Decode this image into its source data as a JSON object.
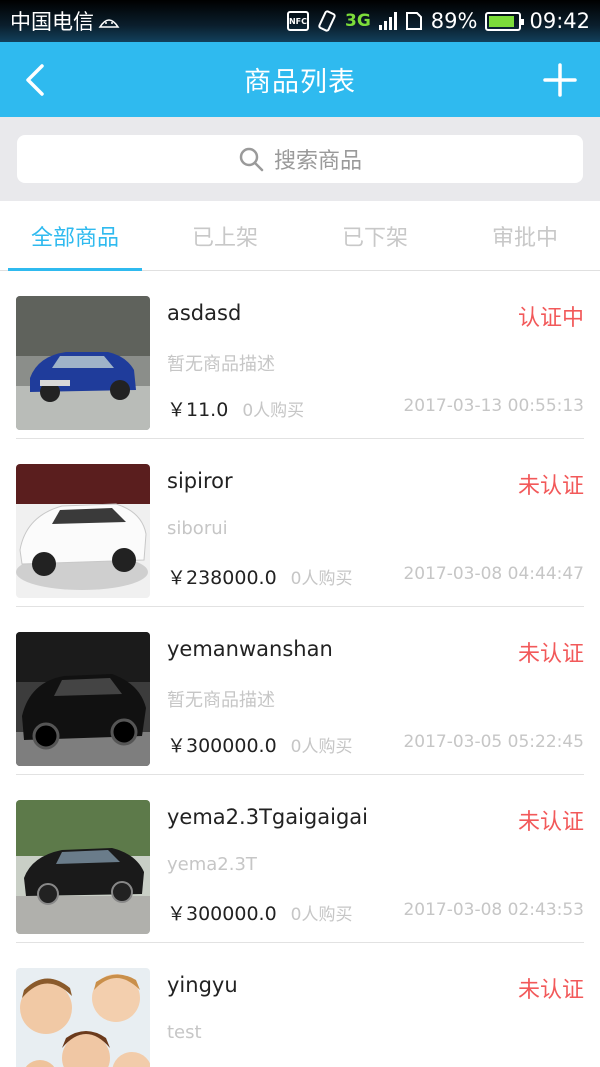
{
  "status_bar": {
    "carrier": "中国电信",
    "nfc_label": "NFC",
    "network": "3G",
    "battery": "89%",
    "battery_level": 0.89,
    "time": "09:42"
  },
  "header": {
    "title": "商品列表",
    "back_icon": "back-chevron-icon",
    "add_icon": "plus-icon"
  },
  "search": {
    "placeholder": "搜索商品"
  },
  "tabs": [
    {
      "label": "全部商品",
      "active": true
    },
    {
      "label": "已上架",
      "active": false
    },
    {
      "label": "已下架",
      "active": false
    },
    {
      "label": "审批中",
      "active": false
    }
  ],
  "colors": {
    "accent": "#2fbaef",
    "status_red": "#f2595a",
    "muted": "#c6c6c6"
  },
  "products": [
    {
      "name": "asdasd",
      "status": "认证中",
      "desc": "暂无商品描述",
      "price": "￥11.0",
      "buyers": "0人购买",
      "date": "2017-03-13 00:55:13"
    },
    {
      "name": "sipiror",
      "status": "未认证",
      "desc": "siborui",
      "price": "￥238000.0",
      "buyers": "0人购买",
      "date": "2017-03-08 04:44:47"
    },
    {
      "name": "yemanwanshan",
      "status": "未认证",
      "desc": "暂无商品描述",
      "price": "￥300000.0",
      "buyers": "0人购买",
      "date": "2017-03-05 05:22:45"
    },
    {
      "name": "yema2.3Tgaigaigai",
      "status": "未认证",
      "desc": "yema2.3T",
      "price": "￥300000.0",
      "buyers": "0人购买",
      "date": "2017-03-08 02:43:53"
    },
    {
      "name": "yingyu",
      "status": "未认证",
      "desc": "test",
      "price": "",
      "buyers": "",
      "date": ""
    }
  ]
}
